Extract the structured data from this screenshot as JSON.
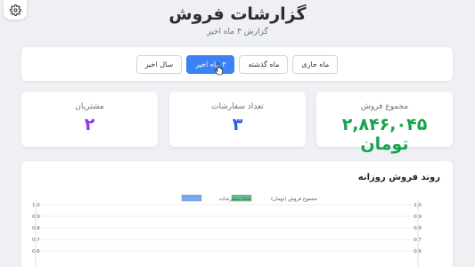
{
  "header": {
    "title": "گزارشات فروش",
    "subtitle": "گزارش ۳ ماه اخیر"
  },
  "filters": {
    "items": [
      {
        "label": "ماه جاری",
        "active": false
      },
      {
        "label": "ماه گذشته",
        "active": false
      },
      {
        "label": "۳ ماه اخیر",
        "active": true
      },
      {
        "label": "سال اخیر",
        "active": false
      }
    ]
  },
  "stats": {
    "sales": {
      "label": "مجموع فروش",
      "value": "۲,۸۴۶,۰۴۵ تومان",
      "color": "#16a34a"
    },
    "orders": {
      "label": "تعداد سفارشات",
      "value": "۳",
      "color": "#2563eb"
    },
    "customers": {
      "label": "مشتریان",
      "value": "۲",
      "color": "#9333ea"
    }
  },
  "chart": {
    "title": "روند فروش روزانه"
  },
  "chart_data": {
    "type": "line",
    "title": "روند فروش روزانه",
    "series": [
      {
        "name": "مجموع فروش (تومان)",
        "color": "#5cc08a",
        "values": []
      },
      {
        "name": "تعداد سفارشات",
        "color": "#7aa7f2",
        "values": []
      }
    ],
    "ylim": [
      0,
      1
    ],
    "y_ticks": [
      "1.0",
      "0.9",
      "0.8",
      "0.7",
      "0.6"
    ],
    "grid": true,
    "legend": "top-center"
  },
  "icons": {
    "settings": "gear-icon"
  }
}
